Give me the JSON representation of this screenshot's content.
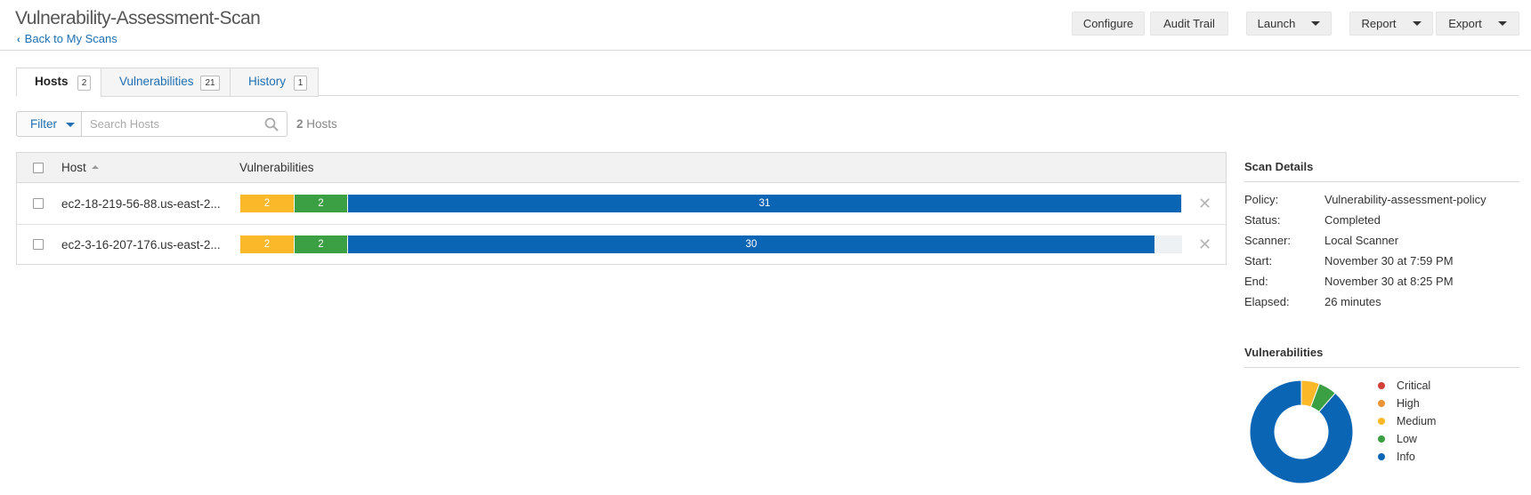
{
  "header": {
    "title": "Vulnerability-Assessment-Scan",
    "back_link": "Back to My Scans",
    "buttons": {
      "configure": "Configure",
      "audit_trail": "Audit Trail",
      "launch": "Launch",
      "report": "Report",
      "export": "Export"
    }
  },
  "tabs": [
    {
      "label": "Hosts",
      "count": "2",
      "active": true
    },
    {
      "label": "Vulnerabilities",
      "count": "21",
      "active": false
    },
    {
      "label": "History",
      "count": "1",
      "active": false
    }
  ],
  "filter": {
    "button_label": "Filter",
    "search_placeholder": "Search Hosts",
    "result_count": "2",
    "result_label": "Hosts"
  },
  "table": {
    "columns": [
      "Host",
      "Vulnerabilities"
    ],
    "rows": [
      {
        "host": "ec2-18-219-56-88.us-east-2...",
        "medium": 2,
        "low": 2,
        "info": 31
      },
      {
        "host": "ec2-3-16-207-176.us-east-2...",
        "medium": 2,
        "low": 2,
        "info": 30
      }
    ]
  },
  "scan_details": {
    "title": "Scan Details",
    "items": [
      {
        "label": "Policy:",
        "value": "Vulnerability-assessment-policy"
      },
      {
        "label": "Status:",
        "value": "Completed"
      },
      {
        "label": "Scanner:",
        "value": "Local Scanner"
      },
      {
        "label": "Start:",
        "value": "November 30 at 7:59 PM"
      },
      {
        "label": "End:",
        "value": "November 30 at 8:25 PM"
      },
      {
        "label": "Elapsed:",
        "value": "26 minutes"
      }
    ]
  },
  "vulnerabilities_panel": {
    "title": "Vulnerabilities",
    "legend": [
      {
        "label": "Critical",
        "color": "#d43f3a",
        "value": 0
      },
      {
        "label": "High",
        "color": "#ee9336",
        "value": 0
      },
      {
        "label": "Medium",
        "color": "#fbb829",
        "value": 2
      },
      {
        "label": "Low",
        "color": "#3aa043",
        "value": 2
      },
      {
        "label": "Info",
        "color": "#0b65b5",
        "value": 31
      }
    ]
  },
  "colors": {
    "link": "#1f6fb2",
    "medium": "#fbb829",
    "low": "#3aa043",
    "info": "#0b65b5"
  }
}
